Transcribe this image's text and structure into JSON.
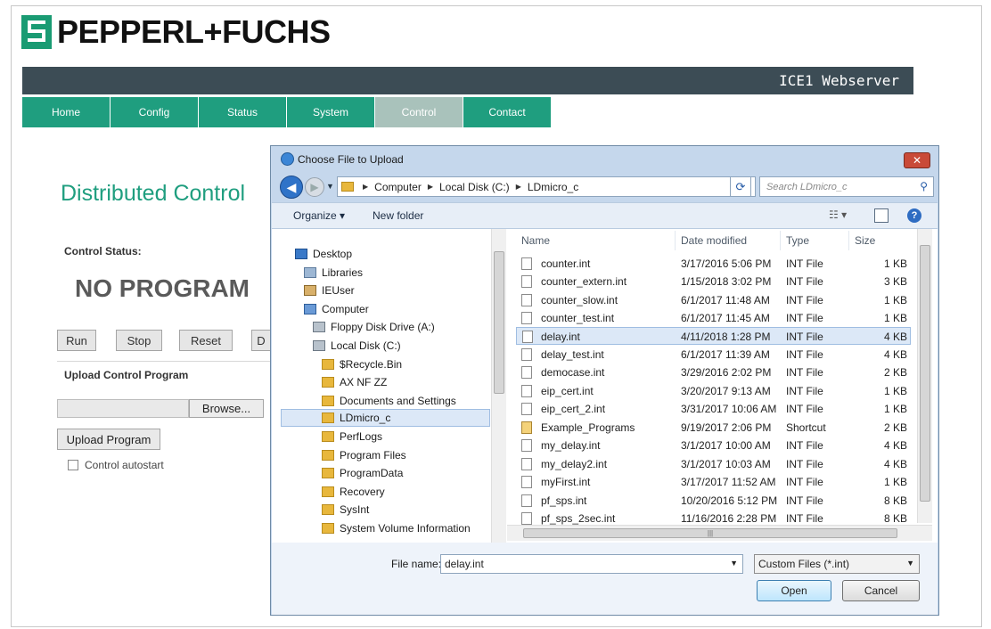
{
  "brand": {
    "name": "PEPPERL+FUCHS",
    "product": "ICE1 Webserver"
  },
  "nav": {
    "tabs": [
      {
        "label": "Home",
        "active": false
      },
      {
        "label": "Config",
        "active": false
      },
      {
        "label": "Status",
        "active": false
      },
      {
        "label": "System",
        "active": false
      },
      {
        "label": "Control",
        "active": true
      },
      {
        "label": "Contact",
        "active": false
      }
    ]
  },
  "page": {
    "heading": "Distributed Control",
    "status_label": "Control Status:",
    "status_value": "NO PROGRAM",
    "buttons": {
      "run": "Run",
      "stop": "Stop",
      "reset": "Reset",
      "delete": "D"
    },
    "upload_label": "Upload Control Program",
    "browse_label": "Browse...",
    "upload_button": "Upload Program",
    "autostart_label": "Control autostart",
    "autostart_checked": false
  },
  "dialog": {
    "title": "Choose File to Upload",
    "close_label": "✕",
    "address": [
      "Computer",
      "Local Disk (C:)",
      "LDmicro_c"
    ],
    "search_placeholder": "Search LDmicro_c",
    "toolbar": {
      "organize": "Organize ▾",
      "new_folder": "New folder"
    },
    "tree": [
      {
        "label": "Desktop",
        "icon": "desktop"
      },
      {
        "label": "Libraries",
        "icon": "library"
      },
      {
        "label": "IEUser",
        "icon": "user"
      },
      {
        "label": "Computer",
        "icon": "computer"
      },
      {
        "label": "Floppy Disk Drive (A:)",
        "icon": "drive"
      },
      {
        "label": "Local Disk (C:)",
        "icon": "drive"
      },
      {
        "label": "$Recycle.Bin",
        "icon": "folder"
      },
      {
        "label": "AX NF ZZ",
        "icon": "folder"
      },
      {
        "label": "Documents and Settings",
        "icon": "folder"
      },
      {
        "label": "LDmicro_c",
        "icon": "folder",
        "selected": true
      },
      {
        "label": "PerfLogs",
        "icon": "folder"
      },
      {
        "label": "Program Files",
        "icon": "folder"
      },
      {
        "label": "ProgramData",
        "icon": "folder"
      },
      {
        "label": "Recovery",
        "icon": "folder"
      },
      {
        "label": "SysInt",
        "icon": "folder"
      },
      {
        "label": "System Volume Information",
        "icon": "folder"
      }
    ],
    "columns": [
      "Name",
      "Date modified",
      "Type",
      "Size"
    ],
    "files": [
      {
        "name": "counter.int",
        "date": "3/17/2016 5:06 PM",
        "type": "INT File",
        "size": "1 KB"
      },
      {
        "name": "counter_extern.int",
        "date": "1/15/2018 3:02 PM",
        "type": "INT File",
        "size": "3 KB"
      },
      {
        "name": "counter_slow.int",
        "date": "6/1/2017 11:48 AM",
        "type": "INT File",
        "size": "1 KB"
      },
      {
        "name": "counter_test.int",
        "date": "6/1/2017 11:45 AM",
        "type": "INT File",
        "size": "1 KB"
      },
      {
        "name": "delay.int",
        "date": "4/11/2018 1:28 PM",
        "type": "INT File",
        "size": "4 KB",
        "selected": true
      },
      {
        "name": "delay_test.int",
        "date": "6/1/2017 11:39 AM",
        "type": "INT File",
        "size": "4 KB"
      },
      {
        "name": "democase.int",
        "date": "3/29/2016 2:02 PM",
        "type": "INT File",
        "size": "2 KB"
      },
      {
        "name": "eip_cert.int",
        "date": "3/20/2017 9:13 AM",
        "type": "INT File",
        "size": "1 KB"
      },
      {
        "name": "eip_cert_2.int",
        "date": "3/31/2017 10:06 AM",
        "type": "INT File",
        "size": "1 KB"
      },
      {
        "name": "Example_Programs",
        "date": "9/19/2017 2:06 PM",
        "type": "Shortcut",
        "size": "2 KB",
        "shortcut": true
      },
      {
        "name": "my_delay.int",
        "date": "3/1/2017 10:00 AM",
        "type": "INT File",
        "size": "4 KB"
      },
      {
        "name": "my_delay2.int",
        "date": "3/1/2017 10:03 AM",
        "type": "INT File",
        "size": "4 KB"
      },
      {
        "name": "myFirst.int",
        "date": "3/17/2017 11:52 AM",
        "type": "INT File",
        "size": "1 KB"
      },
      {
        "name": "pf_sps.int",
        "date": "10/20/2016 5:12 PM",
        "type": "INT File",
        "size": "8 KB"
      },
      {
        "name": "pf_sps_2sec.int",
        "date": "11/16/2016 2:28 PM",
        "type": "INT File",
        "size": "8 KB"
      }
    ],
    "file_name_label": "File name:",
    "file_name_value": "delay.int",
    "filter_value": "Custom Files (*.int)",
    "open_label": "Open",
    "cancel_label": "Cancel"
  },
  "colors": {
    "brand_green": "#1f9e7f",
    "header_dark": "#3c4c55",
    "tab_active": "#a9c2bb",
    "dialog_frame": "#c5d7ec",
    "selection": "#dce8f7"
  }
}
